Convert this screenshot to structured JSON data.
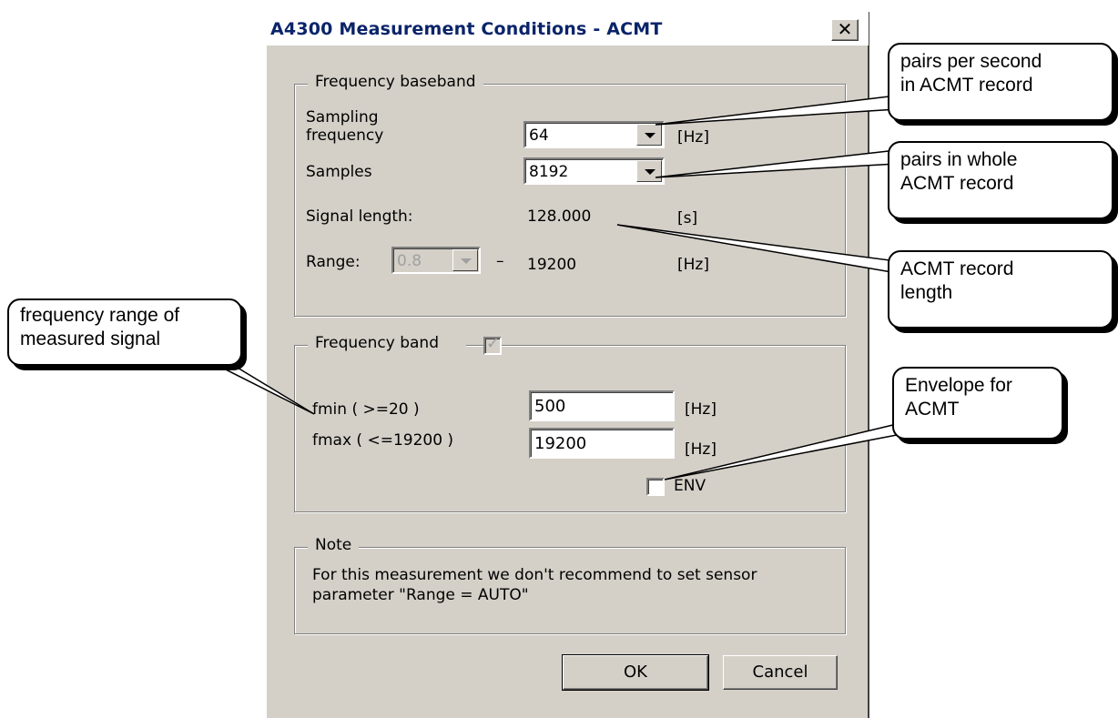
{
  "dialog": {
    "title": "A4300 Measurement Conditions - ACMT",
    "close_symbol": "✕",
    "baseband": {
      "legend": "Frequency baseband",
      "sampling_label_1": "Sampling",
      "sampling_label_2": "frequency",
      "sampling_value": "64",
      "sampling_unit": "[Hz]",
      "samples_label": "Samples",
      "samples_value": "8192",
      "signal_length_label": "Signal length:",
      "signal_length_value": "128.000",
      "signal_length_unit": "[s]",
      "range_label": "Range:",
      "range_from": "0.8",
      "range_dash": "–",
      "range_to": "19200",
      "range_unit": "[Hz]"
    },
    "band": {
      "legend": "Frequency band",
      "checked": true,
      "fmin_label": "fmin  ( >=20 )",
      "fmin_value": "500",
      "fmin_unit": "[Hz]",
      "fmax_label": "fmax  ( <=19200 )",
      "fmax_value": "19200",
      "fmax_unit": "[Hz]",
      "env_label": "ENV",
      "env_checked": false
    },
    "note": {
      "legend": "Note",
      "line1": "For this measurement we don't recommend to set sensor",
      "line2": "parameter \"Range = AUTO\""
    },
    "ok_label": "OK",
    "cancel_label": "Cancel"
  },
  "callouts": {
    "pairs_per_second": [
      "pairs per second",
      "in ACMT record"
    ],
    "pairs_whole": [
      "pairs in whole",
      "ACMT record"
    ],
    "record_length": [
      "ACMT record",
      "length"
    ],
    "freq_range": [
      "frequency range of",
      "measured signal"
    ],
    "envelope": [
      "Envelope for",
      "ACMT"
    ]
  },
  "icons": {
    "close": "close-icon",
    "dropdown": "chevron-down-icon",
    "check": "checkmark-icon"
  },
  "colors": {
    "dialog_bg": "#d4d0c8",
    "title_text": "#0a246a",
    "callout_bg": "#ffffff"
  }
}
